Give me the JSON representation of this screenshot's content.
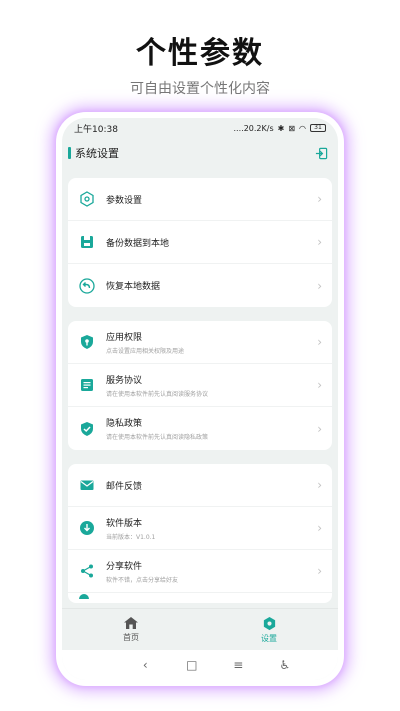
{
  "promo": {
    "title": "个性参数",
    "subtitle": "可自由设置个性化内容"
  },
  "status_bar": {
    "time": "上午10:38",
    "network": "....20.2K/s",
    "battery": "31"
  },
  "header": {
    "title": "系统设置"
  },
  "groups": [
    {
      "items": [
        {
          "label": "参数设置",
          "desc": "",
          "icon": "hexagon-icon"
        },
        {
          "label": "备份数据到本地",
          "desc": "",
          "icon": "floppy-icon"
        },
        {
          "label": "恢复本地数据",
          "desc": "",
          "icon": "restore-icon"
        }
      ]
    },
    {
      "items": [
        {
          "label": "应用权限",
          "desc": "点击设置应用相关权限及用途",
          "icon": "permission-icon"
        },
        {
          "label": "服务协议",
          "desc": "请在使用本软件前先认真阅读服务协议",
          "icon": "agreement-icon"
        },
        {
          "label": "隐私政策",
          "desc": "请在使用本软件前先认真阅读隐私政策",
          "icon": "shield-check-icon"
        }
      ]
    },
    {
      "items": [
        {
          "label": "邮件反馈",
          "desc": "",
          "icon": "mail-icon"
        },
        {
          "label": "软件版本",
          "desc": "当前版本：V1.0.1",
          "icon": "download-icon"
        },
        {
          "label": "分享软件",
          "desc": "软件不错，点击分享给好友",
          "icon": "share-icon"
        }
      ]
    }
  ],
  "tabs": [
    {
      "label": "首页",
      "icon": "home-icon",
      "active": false
    },
    {
      "label": "设置",
      "icon": "settings-hex-icon",
      "active": true
    }
  ],
  "colors": {
    "accent": "#1aa89a",
    "inactive": "#555555"
  },
  "nav": {
    "back": "‹",
    "home": "□",
    "menu": "≡",
    "accessibility": "♿"
  }
}
